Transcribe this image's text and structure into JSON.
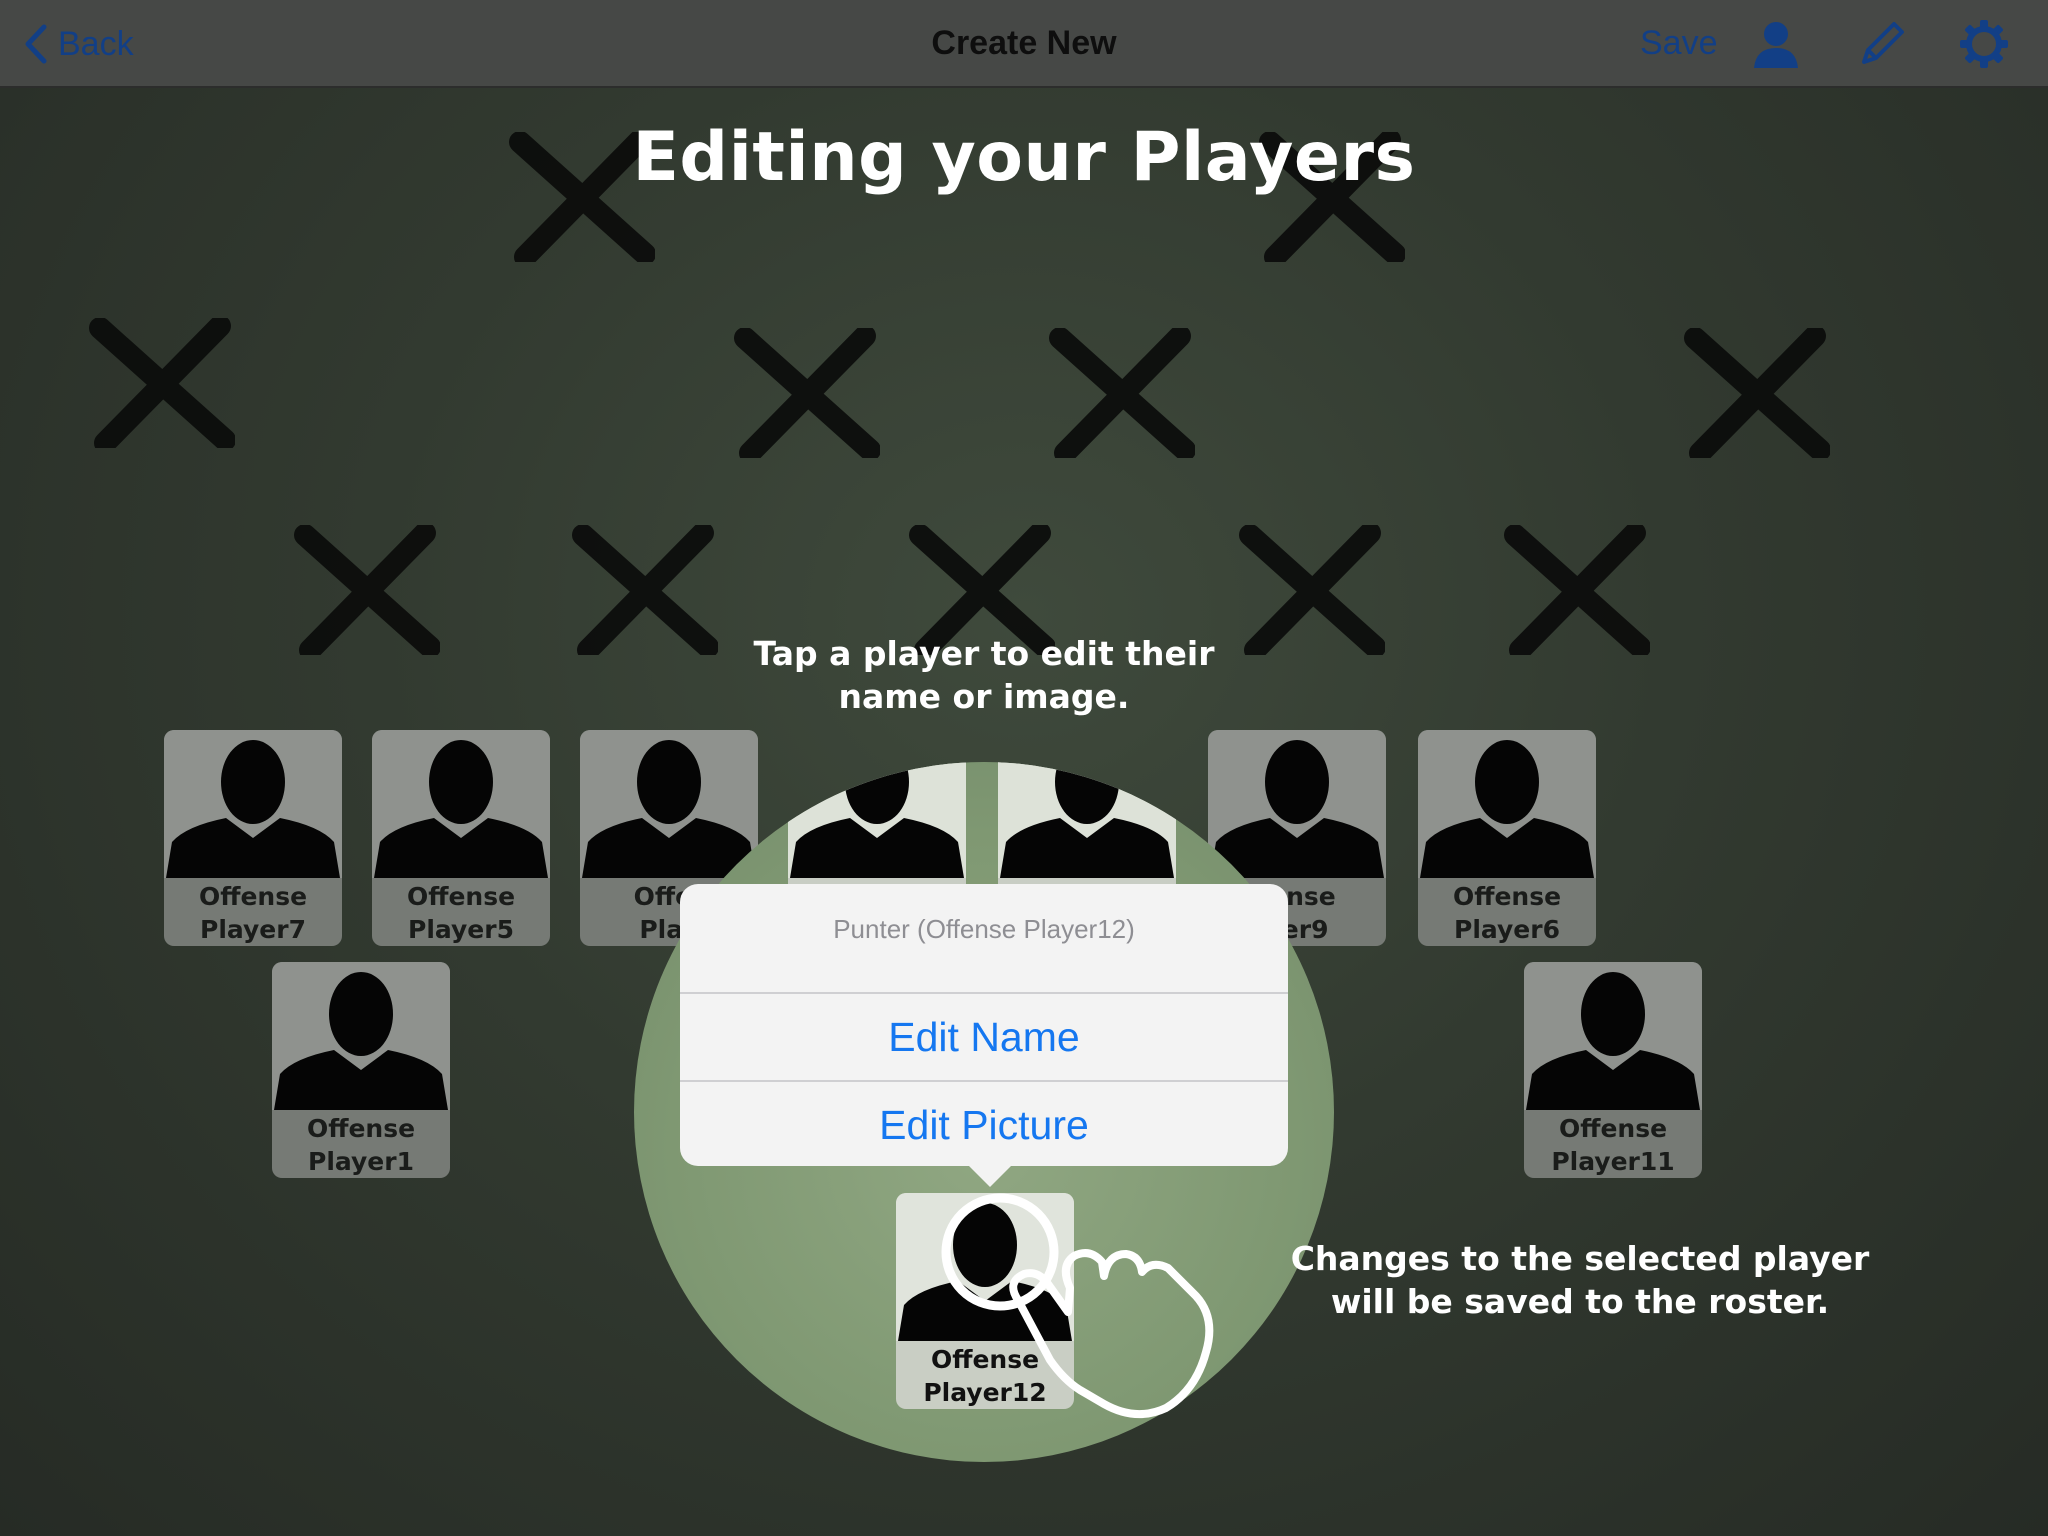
{
  "nav": {
    "back_label": "Back",
    "title": "Create New",
    "save_label": "Save",
    "icons": [
      "person-icon",
      "pencil-icon",
      "gear-icon"
    ],
    "link_color": "#123f86"
  },
  "tutorial": {
    "title": "Editing your Players",
    "tap_hint_line1": "Tap a player to edit their",
    "tap_hint_line2": "name or image.",
    "save_hint_line1": "Changes to the selected player",
    "save_hint_line2": "will be saved to the roster."
  },
  "players": [
    {
      "line1": "Offense",
      "line2": "Player7"
    },
    {
      "line1": "Offense",
      "line2": "Player5"
    },
    {
      "line1": "Offer",
      "line2": "Play"
    },
    {
      "line1": "",
      "line2": ""
    },
    {
      "line1": "",
      "line2": ""
    },
    {
      "line1": "fense",
      "line2": "yer9"
    },
    {
      "line1": "Offense",
      "line2": "Player6"
    },
    {
      "line1": "Offense",
      "line2": "Player1"
    },
    {
      "line1": "Offense",
      "line2": "Player11"
    }
  ],
  "selected_player": {
    "line1": "Offense",
    "line2": "Player12"
  },
  "popover": {
    "title": "Punter  (Offense Player12)",
    "edit_name": "Edit Name",
    "edit_picture": "Edit Picture",
    "action_color": "#1577f0"
  }
}
